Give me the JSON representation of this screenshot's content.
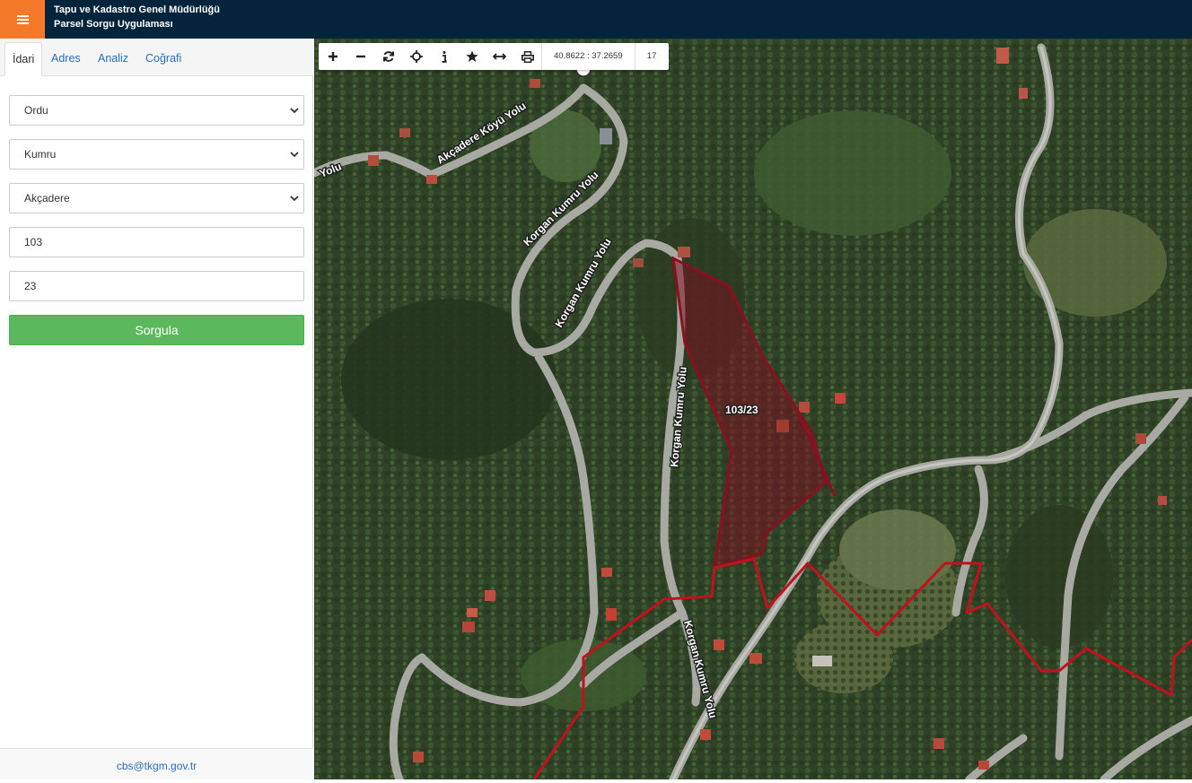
{
  "header": {
    "title_line1": "Tapu ve Kadastro Genel Müdürlüğü",
    "title_line2": "Parsel Sorgu Uygulaması",
    "menu_icon": "hamburger-icon",
    "accent_color": "#f47a2a",
    "bar_color": "#03243a"
  },
  "tabs": [
    {
      "label": "İdari",
      "active": true
    },
    {
      "label": "Adres",
      "active": false
    },
    {
      "label": "Analiz",
      "active": false
    },
    {
      "label": "Coğrafi",
      "active": false
    }
  ],
  "form": {
    "il": "Ordu",
    "ilce": "Kumru",
    "mahalle": "Akçadere",
    "ada": "103",
    "parsel": "23",
    "submit_label": "Sorgula",
    "submit_color": "#5cb85c"
  },
  "footer": {
    "email": "cbs@tkgm.gov.tr"
  },
  "toolbar": {
    "tools": [
      "zoom-in-icon",
      "zoom-out-icon",
      "refresh-icon",
      "locate-icon",
      "info-icon",
      "favorite-icon",
      "measure-icon",
      "print-icon"
    ],
    "coordinates": "40.8622 : 37.2659",
    "zoom_level": "17"
  },
  "map": {
    "parcel_label": "103/23",
    "parcel_color": "#8b0f1e",
    "boundary_color": "#c4101c",
    "road_labels": [
      "Akçadere Köyü Yolu",
      "Korgan Kumru Yolu",
      "Korgan Kumru Yolu",
      "Korgan Kumru Yolu",
      "Korgan Kumru Yolu",
      "Yolu"
    ]
  }
}
